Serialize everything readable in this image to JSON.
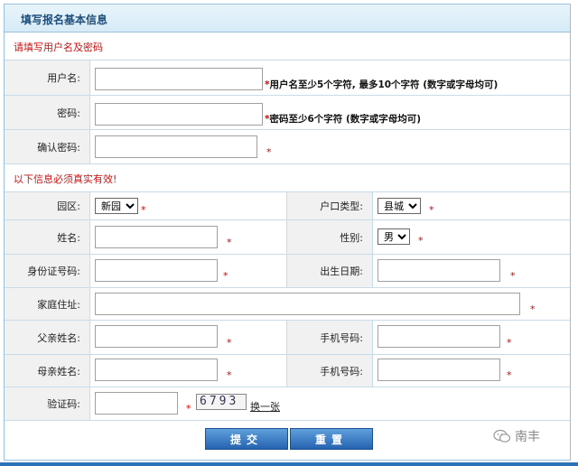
{
  "header": {
    "title": "填写报名基本信息"
  },
  "section1": {
    "title": "请填写用户名及密码"
  },
  "section2": {
    "title": "以下信息必须真实有效!"
  },
  "fields": {
    "username": {
      "label": "用户名:",
      "value": "",
      "hint": "用户名至少5个字符, 最多10个字符 (数字或字母均可)"
    },
    "password": {
      "label": "密码:",
      "value": "",
      "hint": "密码至少6个字符 (数字或字母均可)"
    },
    "confirm": {
      "label": "确认密码:",
      "value": ""
    },
    "park": {
      "label": "园区:",
      "selected": "新园"
    },
    "hukou": {
      "label": "户口类型:",
      "selected": "县城"
    },
    "name": {
      "label": "姓名:",
      "value": ""
    },
    "gender": {
      "label": "性别:",
      "selected": "男"
    },
    "idcard": {
      "label": "身份证号码:",
      "value": ""
    },
    "birth": {
      "label": "出生日期:",
      "value": ""
    },
    "address": {
      "label": "家庭住址:",
      "value": ""
    },
    "father": {
      "label": "父亲姓名:",
      "value": ""
    },
    "phone1": {
      "label": "手机号码:",
      "value": ""
    },
    "mother": {
      "label": "母亲姓名:",
      "value": ""
    },
    "phone2": {
      "label": "手机号码:",
      "value": ""
    },
    "captcha": {
      "label": "验证码:",
      "value": "",
      "code": "6793",
      "refresh": "换一张"
    }
  },
  "required_mark": "*",
  "buttons": {
    "submit": "提交",
    "reset": "重置"
  },
  "watermark": {
    "text": "南丰"
  },
  "colors": {
    "accent": "#2563b0",
    "required": "#dd0000",
    "header_text": "#1f4e7a"
  }
}
